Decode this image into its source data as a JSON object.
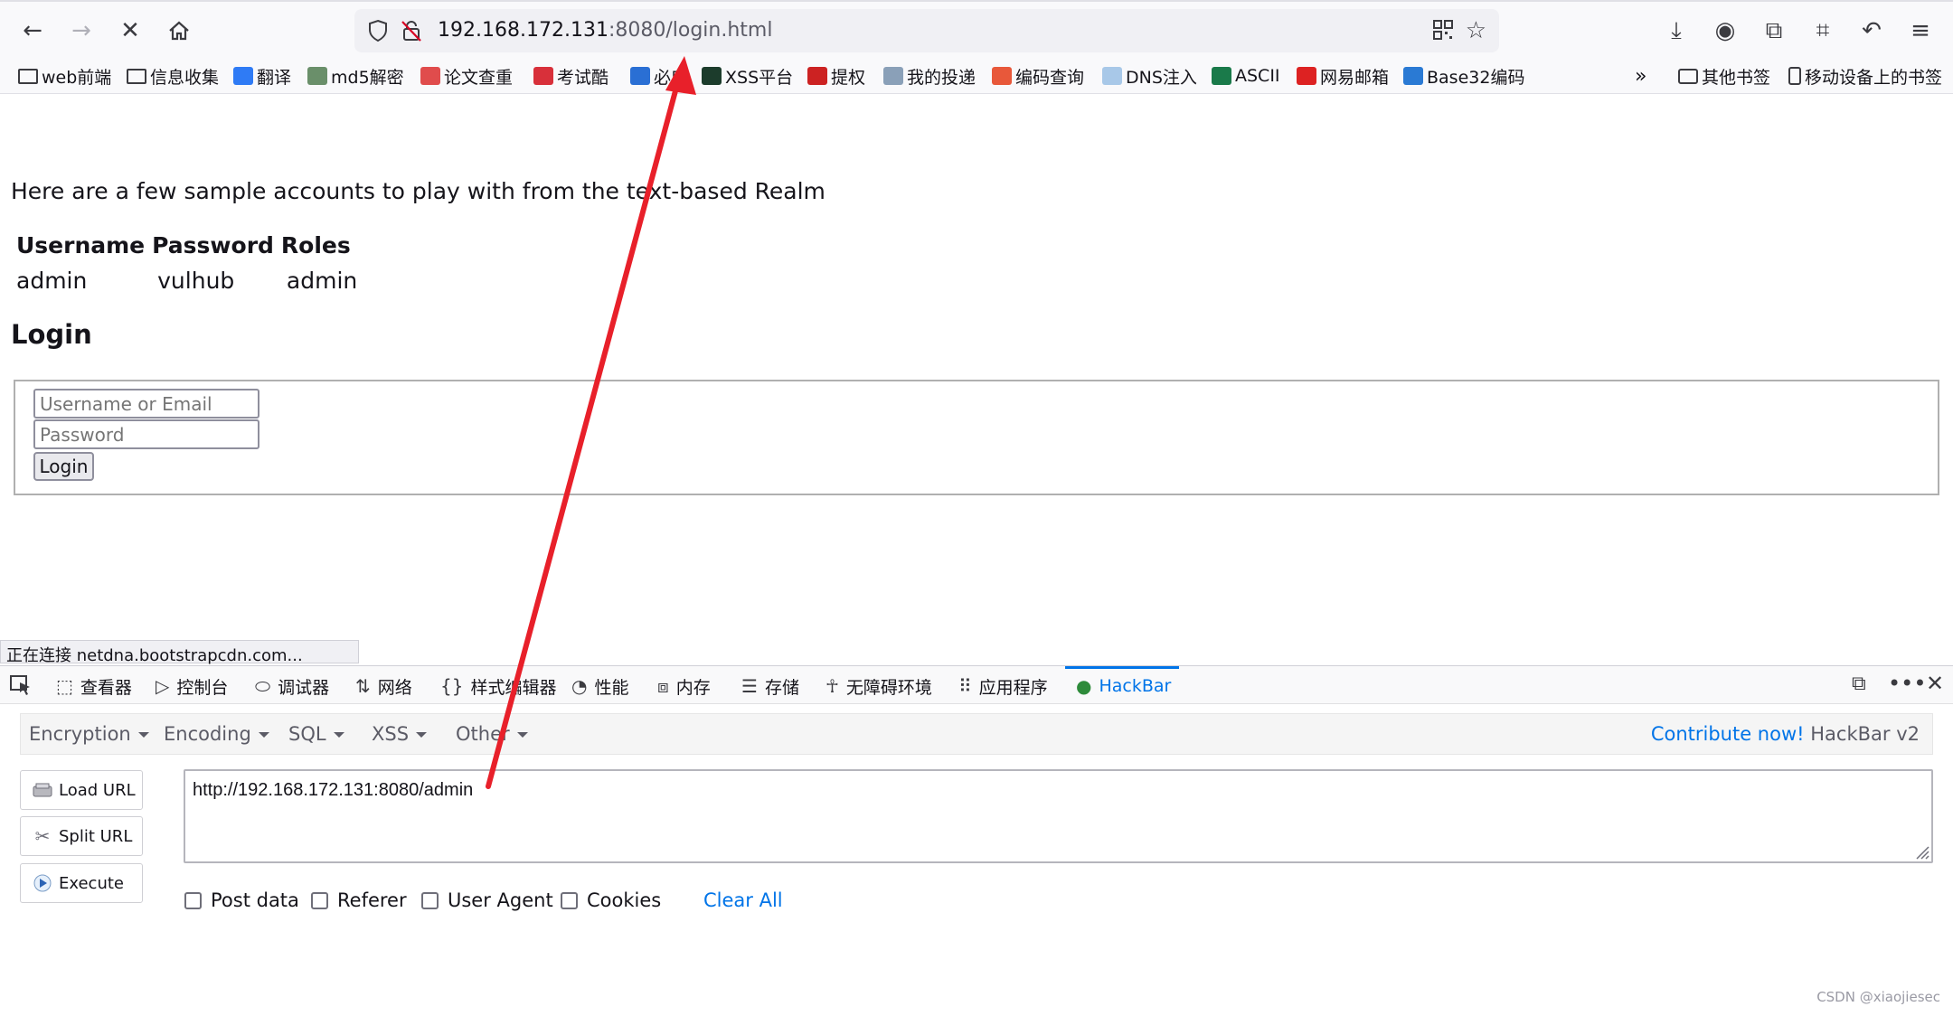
{
  "browser": {
    "url_host": "192.168.172.131",
    "url_rest": ":8080/login.html"
  },
  "bookmarks": [
    {
      "label": "web前端",
      "icon": "folder-icon"
    },
    {
      "label": "信息收集",
      "icon": "folder-icon"
    },
    {
      "label": "翻译",
      "icon": "translate-icon"
    },
    {
      "label": "md5解密",
      "icon": "md5-icon"
    },
    {
      "label": "论文查重",
      "icon": "paper-check-icon"
    },
    {
      "label": "考试酷",
      "icon": "exam-icon"
    },
    {
      "label": "必应",
      "icon": "search-icon"
    },
    {
      "label": "XSS平台",
      "icon": "xss-icon"
    },
    {
      "label": "提权",
      "icon": "grid-icon"
    },
    {
      "label": "我的投递",
      "icon": "delivery-icon"
    },
    {
      "label": "编码查询",
      "icon": "encode-icon"
    },
    {
      "label": "DNS注入",
      "icon": "dns-icon"
    },
    {
      "label": "ASCII",
      "icon": "ascii-icon"
    },
    {
      "label": "网易邮箱",
      "icon": "mail-icon"
    },
    {
      "label": "Base32编码",
      "icon": "base32-icon"
    }
  ],
  "bookmarks_right": [
    {
      "label": "其他书签",
      "icon": "folder-icon"
    },
    {
      "label": "移动设备上的书签",
      "icon": "mobile-icon"
    }
  ],
  "page": {
    "intro": "Here are a few sample accounts to play with from the text-based Realm",
    "table_headers": [
      "Username",
      "Password",
      "Roles"
    ],
    "table_rows": [
      [
        "admin",
        "vulhub",
        "admin"
      ]
    ],
    "login_heading": "Login",
    "username_placeholder": "Username or Email",
    "password_placeholder": "Password",
    "login_button": "Login"
  },
  "status_line": "正在连接 netdna.bootstrapcdn.com...",
  "devtools": {
    "tabs": [
      {
        "label": "查看器",
        "icon": "inspector-icon",
        "glyph": "⬚"
      },
      {
        "label": "控制台",
        "icon": "console-icon",
        "glyph": "▷"
      },
      {
        "label": "调试器",
        "icon": "debugger-icon",
        "glyph": "⬭"
      },
      {
        "label": "网络",
        "icon": "network-icon",
        "glyph": "⇅"
      },
      {
        "label": "样式编辑器",
        "icon": "style-editor-icon",
        "glyph": "{}"
      },
      {
        "label": "性能",
        "icon": "performance-icon",
        "glyph": "◔"
      },
      {
        "label": "内存",
        "icon": "memory-icon",
        "glyph": "⧈"
      },
      {
        "label": "存储",
        "icon": "storage-icon",
        "glyph": "☰"
      },
      {
        "label": "无障碍环境",
        "icon": "accessibility-icon",
        "glyph": "☥"
      },
      {
        "label": "应用程序",
        "icon": "application-icon",
        "glyph": "⠿"
      },
      {
        "label": "HackBar",
        "icon": "hackbar-icon",
        "glyph": "●"
      }
    ]
  },
  "hackbar": {
    "menus": [
      "Encryption",
      "Encoding",
      "SQL",
      "XSS",
      "Other"
    ],
    "contribute": "Contribute now!",
    "version": "HackBar v2",
    "load_url": "Load URL",
    "split_url": "Split URL",
    "execute": "Execute",
    "url_value": "http://192.168.172.131:8080/admin",
    "options": [
      "Post data",
      "Referer",
      "User Agent",
      "Cookies"
    ],
    "clear_all": "Clear All"
  },
  "watermark": "CSDN @xiaojiesec",
  "colors": {
    "accent": "#0074e8",
    "annotation_arrow": "#e8202a"
  }
}
